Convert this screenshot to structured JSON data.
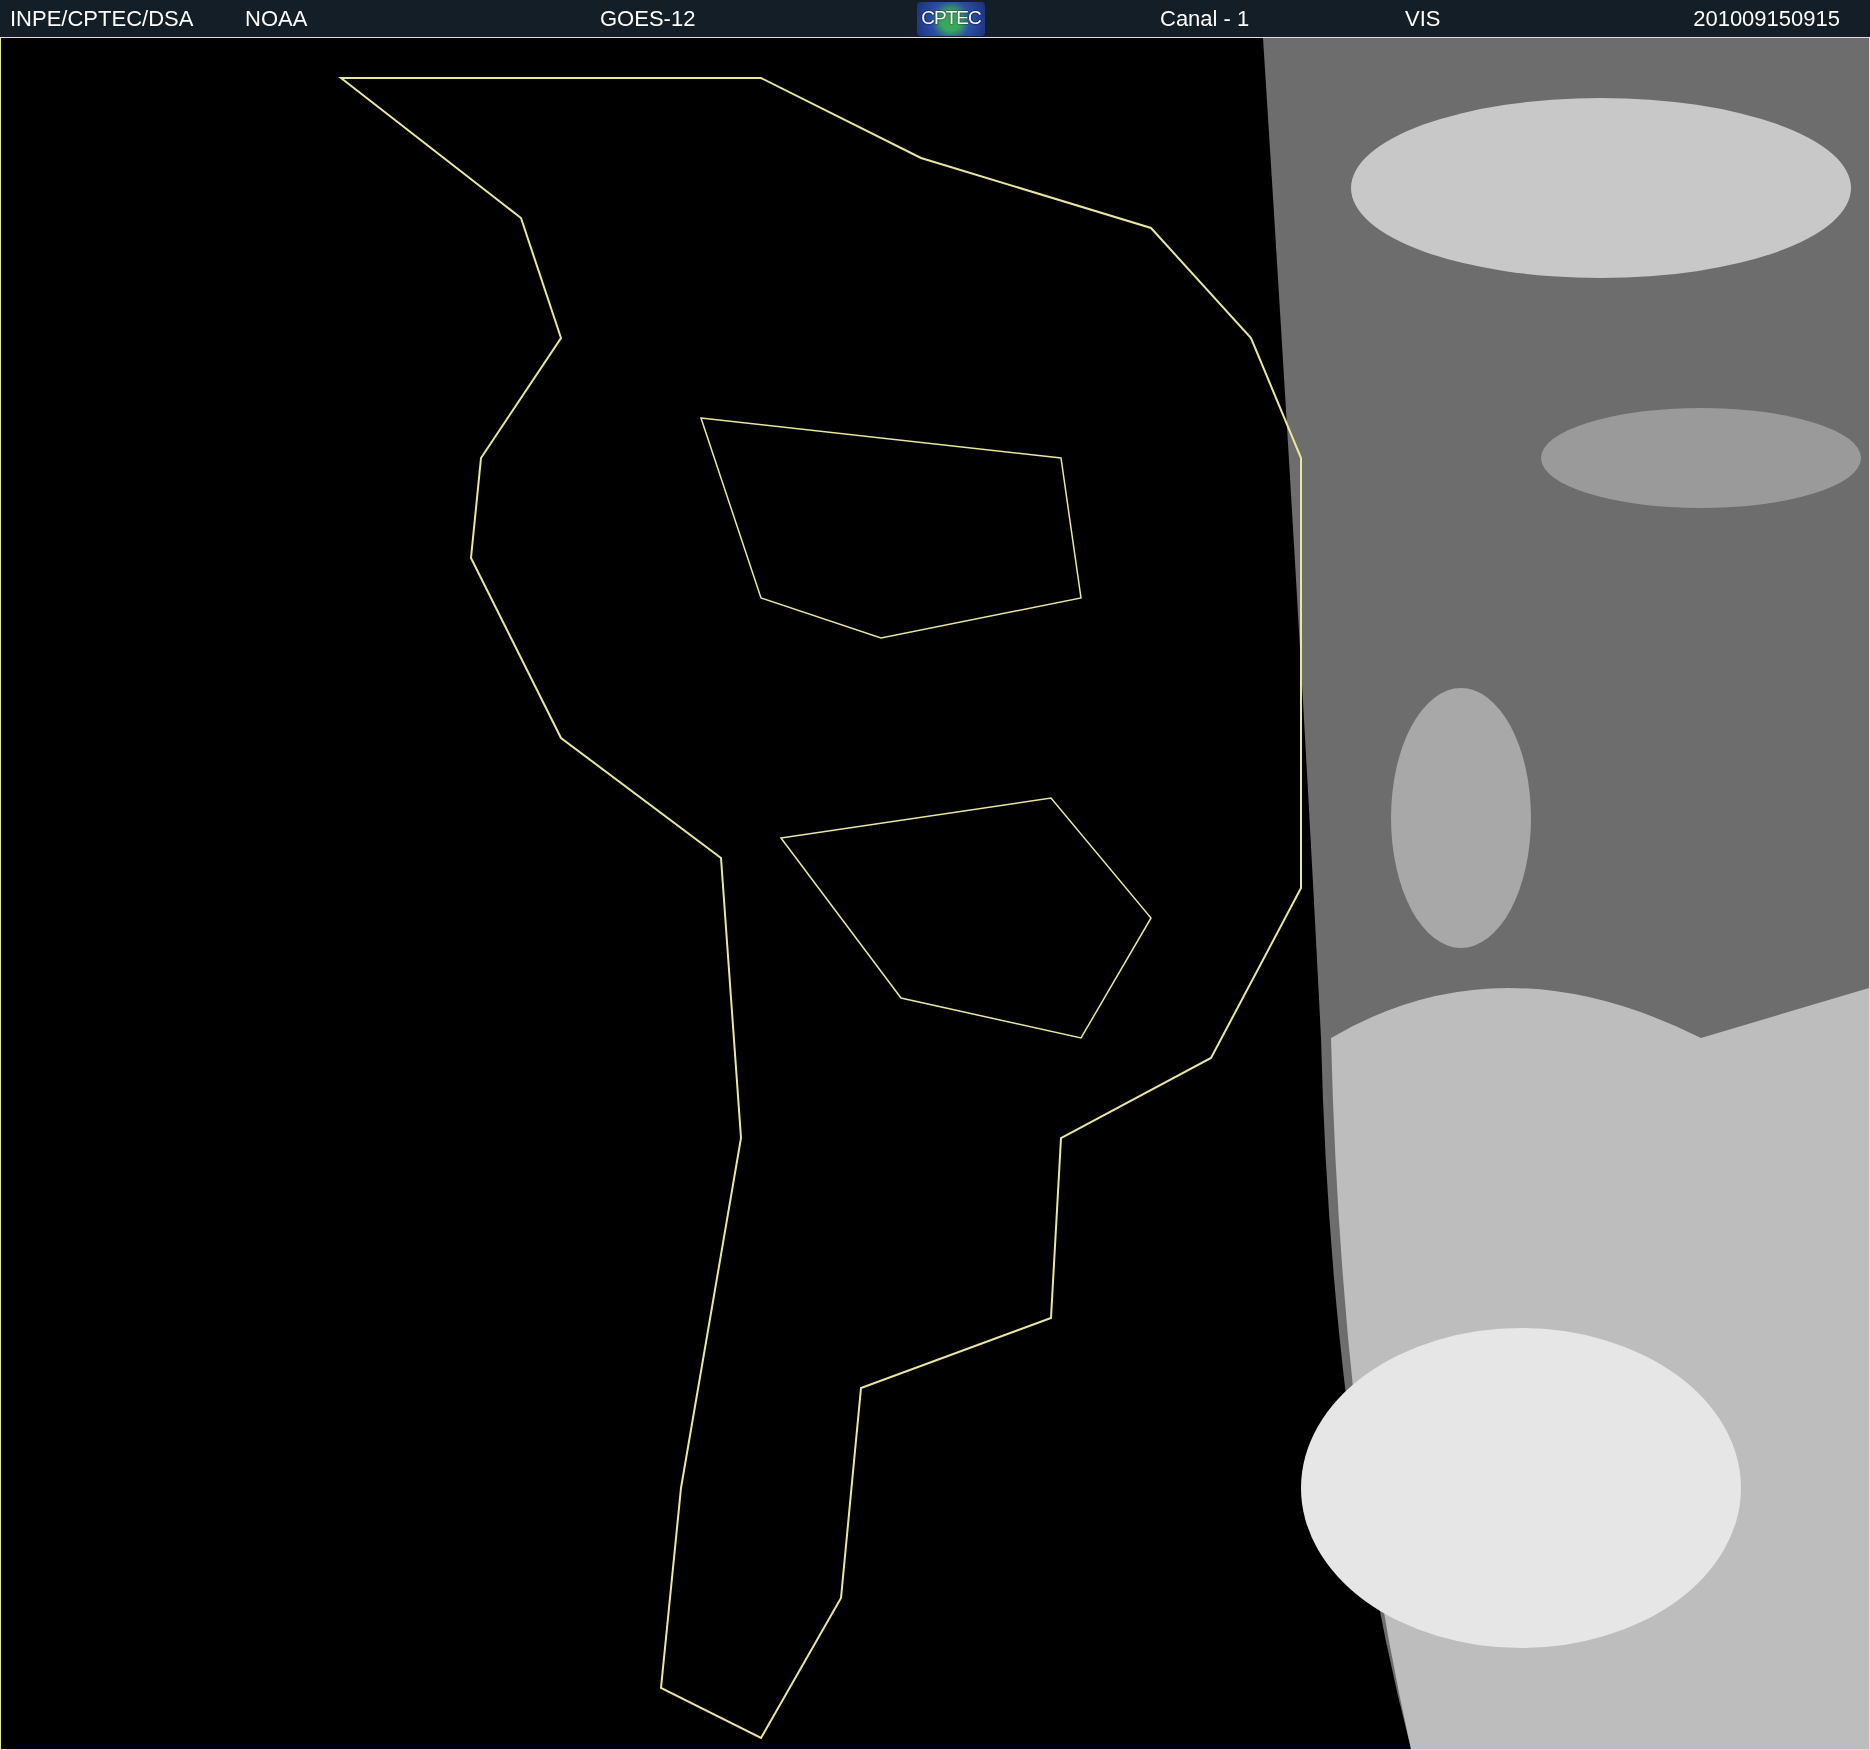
{
  "header": {
    "items": [
      {
        "kind": "text",
        "text": "INPE/CPTEC/DSA"
      },
      {
        "kind": "text",
        "text": "NOAA"
      },
      {
        "kind": "text",
        "text": "GOES-12"
      },
      {
        "kind": "logo",
        "text": "CPTEC"
      },
      {
        "kind": "text",
        "text": "Canal - 1"
      },
      {
        "kind": "text",
        "text": "VIS"
      },
      {
        "kind": "text",
        "text": "201009150915"
      }
    ]
  }
}
